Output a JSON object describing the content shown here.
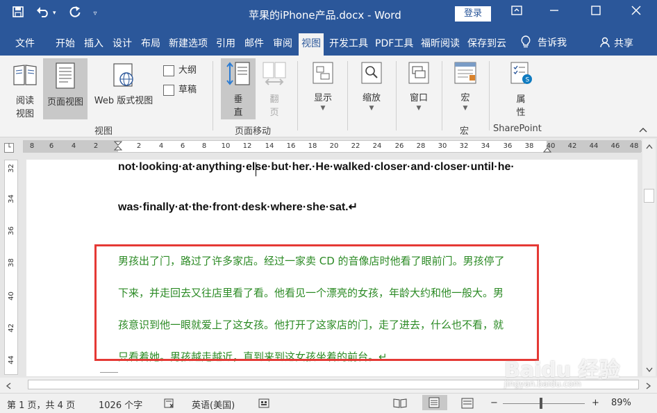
{
  "title_bar": {
    "doc_title": "苹果的iPhone产品.docx  -  Word",
    "login_label": "登录",
    "save_icon": "save-icon",
    "undo_icon": "undo-icon",
    "redo_icon": "redo-icon"
  },
  "tabs": [
    {
      "label": "文件"
    },
    {
      "label": "开始"
    },
    {
      "label": "插入"
    },
    {
      "label": "设计"
    },
    {
      "label": "布局"
    },
    {
      "label": "新建选项"
    },
    {
      "label": "引用"
    },
    {
      "label": "邮件"
    },
    {
      "label": "审阅"
    },
    {
      "label": "视图"
    },
    {
      "label": "开发工具"
    },
    {
      "label": "PDF工具"
    },
    {
      "label": "福昕阅读"
    },
    {
      "label": "保存到云"
    }
  ],
  "tell_me": "告诉我",
  "share": "共享",
  "ribbon": {
    "read_view": "阅读\n视图",
    "read_view_1": "阅读",
    "read_view_2": "视图",
    "page_view": "页面视图",
    "web_view": "Web 版式视图",
    "outline": "大纲",
    "draft": "草稿",
    "group_view": "视图",
    "vertical_1": "垂",
    "vertical_2": "直",
    "flip_1": "翻",
    "flip_2": "页",
    "group_page_move": "页面移动",
    "show": "显示",
    "zoom": "缩放",
    "window": "窗口",
    "macro": "宏",
    "group_macro": "宏",
    "props_1": "属",
    "props_2": "性",
    "group_sharepoint": "SharePoint"
  },
  "ruler": {
    "ticks": [
      "8",
      "6",
      "4",
      "2",
      "2",
      "4",
      "6",
      "8",
      "10",
      "12",
      "14",
      "16",
      "18",
      "20",
      "22",
      "24",
      "26",
      "28",
      "30",
      "32",
      "34",
      "36",
      "38",
      "40",
      "42",
      "44",
      "46",
      "48"
    ],
    "vticks": [
      "32",
      "34",
      "36",
      "38",
      "40",
      "42",
      "44"
    ]
  },
  "document": {
    "eng_line1": "not·looking·at·anything·else·but·her.·He·walked·closer·and·closer·until·he·",
    "eng_line2": "was·finally·at·the·front·desk·where·she·sat.↵",
    "cn_line1": "男孩出了门，路过了许多家店。经过一家卖 CD 的音像店时他看了眼前门。男孩停了",
    "cn_line2": "下来，并走回去又往店里看了看。他看见一个漂亮的女孩，年龄大约和他一般大。男",
    "cn_line3": "孩意识到他一眼就爱上了这女孩。他打开了这家店的门，走了进去，什么也不看，就",
    "cn_line4": "只看着她。男孩越走越近，直到来到这女孩坐着的前台。↵"
  },
  "status": {
    "page": "第 1 页，共 4 页",
    "words": "1026 个字",
    "language": "英语(美国)",
    "zoom_level": "89%",
    "minus": "−",
    "plus": "+"
  },
  "watermark": {
    "text": "Baidu 经验",
    "sub": "jingyan.baidu.com"
  }
}
